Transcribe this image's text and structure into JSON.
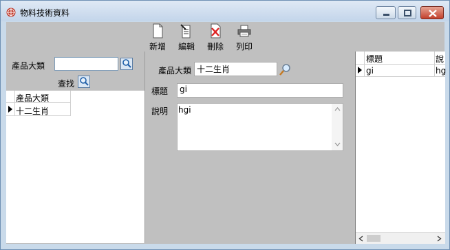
{
  "window": {
    "title": "物料技術資料"
  },
  "toolbar": {
    "new_label": "新增",
    "edit_label": "編輯",
    "delete_label": "刪除",
    "print_label": "列印"
  },
  "left_panel": {
    "category_label": "產品大類",
    "category_value": "",
    "search_label": "查找",
    "grid_header": "產品大類",
    "rows": [
      "十二生肖"
    ]
  },
  "form": {
    "category_label": "產品大類",
    "category_value": "十二生肖",
    "title_label": "標題",
    "title_value": "gi",
    "desc_label": "說明",
    "desc_value": "hgi"
  },
  "right_grid": {
    "headers": [
      "標題",
      "說"
    ],
    "rows": [
      [
        "gi",
        "hg"
      ]
    ]
  },
  "colors": {
    "title_bar": "#c9daea",
    "close_button": "#c2402c",
    "client": "#c0c0c0"
  }
}
